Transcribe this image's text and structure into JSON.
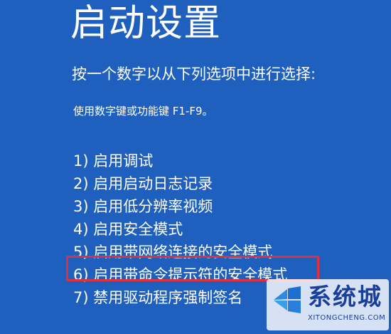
{
  "screen": {
    "title": "启动设置",
    "prompt": "按一个数字以从下列选项中进行选择:",
    "hint": "使用数字键或功能键 F1-F9。",
    "options": [
      {
        "label": "1) 启用调试"
      },
      {
        "label": "2) 启用启动日志记录"
      },
      {
        "label": "3) 启用低分辨率视频"
      },
      {
        "label": "4) 启用安全模式"
      },
      {
        "label": "5) 启用带网络连接的安全模式"
      },
      {
        "label": "6) 启用带命令提示符的安全模式"
      },
      {
        "label": "7) 禁用驱动程序强制签名"
      }
    ],
    "highlighted_option": "5) 启用带网络连接的安全模式"
  },
  "watermark": {
    "logo_icon": "windows-logo-icon",
    "brand": "系统城",
    "url": "XITONGCHENG.COM"
  },
  "colors": {
    "background": "#1f60be",
    "text": "#ffffff",
    "highlight_border": "#e0303a",
    "watermark_text": "#1a3f9a"
  }
}
